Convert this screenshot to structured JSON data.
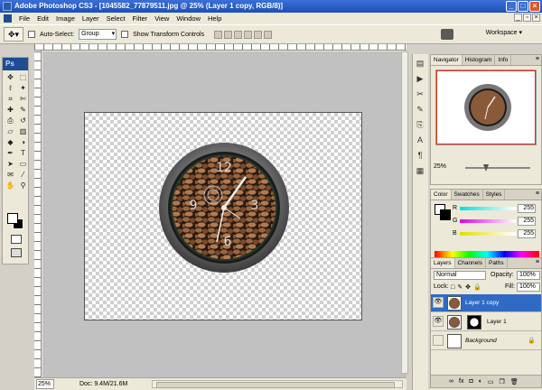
{
  "window": {
    "title": "Adobe Photoshop CS3 - [1045582_77879511.jpg @ 25% (Layer 1 copy, RGB/8)]"
  },
  "menu": [
    "File",
    "Edit",
    "Image",
    "Layer",
    "Select",
    "Filter",
    "View",
    "Window",
    "Help"
  ],
  "options": {
    "auto_select_label": "Auto-Select:",
    "auto_select_value": "Group",
    "show_transform_label": "Show Transform Controls",
    "workspace_label": "Workspace ▾"
  },
  "toolbox": {
    "logo": "Ps",
    "tools": [
      "move-icon",
      "marquee-icon",
      "lasso-icon",
      "magic-wand-icon",
      "crop-icon",
      "slice-icon",
      "healing-icon",
      "brush-icon",
      "stamp-icon",
      "history-brush-icon",
      "eraser-icon",
      "gradient-icon",
      "blur-icon",
      "dodge-icon",
      "pen-icon",
      "type-icon",
      "path-select-icon",
      "shape-icon",
      "notes-icon",
      "eyedropper-icon",
      "hand-icon",
      "zoom-icon"
    ]
  },
  "status": {
    "zoom": "25%",
    "doc_info": "Doc: 9.4M/21.6M"
  },
  "navigator": {
    "tabs": [
      "Navigator",
      "Histogram",
      "Info"
    ],
    "zoom": "25%"
  },
  "color": {
    "tabs": [
      "Color",
      "Swatches",
      "Styles"
    ],
    "channels": [
      {
        "label": "R",
        "value": "255",
        "color": "#00e0e0"
      },
      {
        "label": "G",
        "value": "255",
        "color": "#e000e0"
      },
      {
        "label": "B",
        "value": "255",
        "color": "#e0e000"
      }
    ]
  },
  "layers": {
    "tabs": [
      "Layers",
      "Channels",
      "Paths"
    ],
    "blend_mode": "Normal",
    "opacity_label": "Opacity:",
    "opacity": "100%",
    "lock_label": "Lock:",
    "fill_label": "Fill:",
    "fill": "100%",
    "items": [
      {
        "name": "Layer 1 copy",
        "selected": true
      },
      {
        "name": "Layer 1",
        "selected": false
      },
      {
        "name": "Background",
        "selected": false,
        "locked": true
      }
    ]
  },
  "colors": {
    "title_blue": "#1d4fb5",
    "selection_blue": "#316ac5",
    "canvas_gray": "#c1c1c1"
  }
}
